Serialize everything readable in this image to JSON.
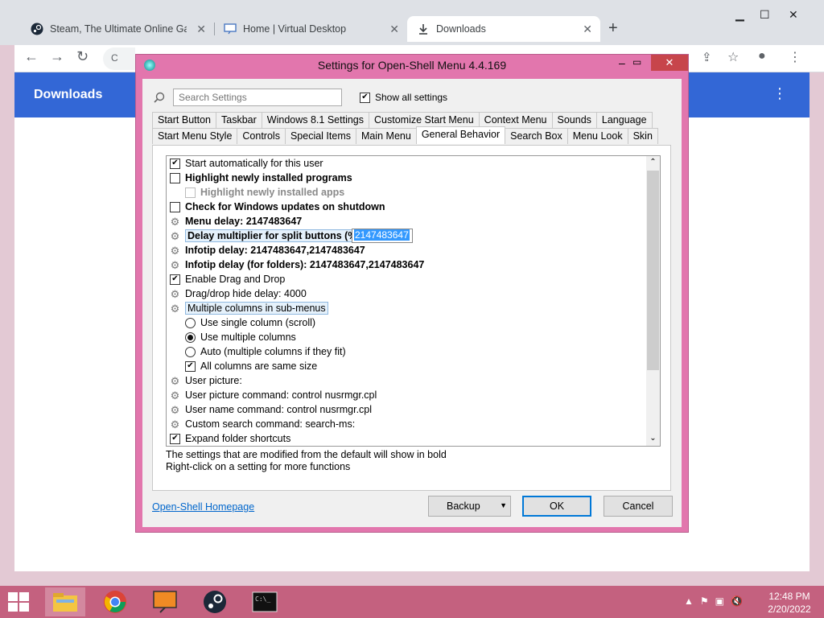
{
  "browser": {
    "tabs": [
      {
        "title": "Steam, The Ultimate Online Gam",
        "icon": "steam-icon"
      },
      {
        "title": "Home | Virtual Desktop",
        "icon": "monitor-icon"
      },
      {
        "title": "Downloads",
        "icon": "download-icon"
      }
    ],
    "omnibox_prefix": "C",
    "page_title": "Downloads"
  },
  "dialog": {
    "title": "Settings for Open-Shell Menu 4.4.169",
    "search_placeholder": "Search Settings",
    "show_all_label": "Show all settings",
    "show_all_checked": true,
    "tabs_row1": [
      "Start Button",
      "Taskbar",
      "Windows 8.1 Settings",
      "Customize Start Menu",
      "Context Menu",
      "Sounds",
      "Language"
    ],
    "tabs_row2": [
      "Start Menu Style",
      "Controls",
      "Special Items",
      "Main Menu",
      "General Behavior",
      "Search Box",
      "Menu Look",
      "Skin"
    ],
    "active_tab": "General Behavior",
    "settings": [
      {
        "type": "checkbox",
        "checked": true,
        "bold": false,
        "indent": 0,
        "label": "Start automatically for this user"
      },
      {
        "type": "checkbox",
        "checked": false,
        "bold": true,
        "indent": 0,
        "label": "Highlight newly installed programs"
      },
      {
        "type": "checkbox",
        "checked": false,
        "bold": true,
        "indent": 1,
        "disabled": true,
        "label": "Highlight newly installed apps"
      },
      {
        "type": "checkbox",
        "checked": false,
        "bold": true,
        "indent": 0,
        "label": "Check for Windows updates on shutdown"
      },
      {
        "type": "gear",
        "bold": true,
        "indent": 0,
        "label": "Menu delay: 2147483647"
      },
      {
        "type": "gear",
        "bold": true,
        "indent": 0,
        "selected": true,
        "label": "Delay multiplier for split buttons (%)"
      },
      {
        "type": "gear",
        "bold": true,
        "indent": 0,
        "label": "Infotip delay: 2147483647,2147483647"
      },
      {
        "type": "gear",
        "bold": true,
        "indent": 0,
        "label": "Infotip delay (for folders): 2147483647,2147483647"
      },
      {
        "type": "checkbox",
        "checked": true,
        "bold": false,
        "indent": 0,
        "label": "Enable Drag and Drop"
      },
      {
        "type": "gear",
        "bold": false,
        "indent": 0,
        "label": "Drag/drop hide delay: 4000"
      },
      {
        "type": "gear",
        "bold": false,
        "indent": 0,
        "selected": true,
        "label": "Multiple columns in sub-menus"
      },
      {
        "type": "radio",
        "checked": false,
        "bold": false,
        "indent": 1,
        "label": "Use single column (scroll)"
      },
      {
        "type": "radio",
        "checked": true,
        "bold": false,
        "indent": 1,
        "label": "Use multiple columns"
      },
      {
        "type": "radio",
        "checked": false,
        "bold": false,
        "indent": 1,
        "label": "Auto (multiple columns if they fit)"
      },
      {
        "type": "checkbox",
        "checked": true,
        "bold": false,
        "indent": 1,
        "label": "All columns are same size"
      },
      {
        "type": "gear",
        "bold": false,
        "indent": 0,
        "label": "User picture:"
      },
      {
        "type": "gear",
        "bold": false,
        "indent": 0,
        "label": "User picture command: control nusrmgr.cpl"
      },
      {
        "type": "gear",
        "bold": false,
        "indent": 0,
        "label": "User name command: control nusrmgr.cpl"
      },
      {
        "type": "gear",
        "bold": false,
        "indent": 0,
        "label": "Custom search command: search-ms:"
      },
      {
        "type": "checkbox",
        "checked": true,
        "bold": false,
        "indent": 0,
        "label": "Expand folder shortcuts"
      }
    ],
    "edit_value": "2147483647",
    "info_line1": "The settings that are modified from the default will show in bold",
    "info_line2": "Right-click on a setting for more functions",
    "homepage_link": "Open-Shell Homepage",
    "backup_label": "Backup",
    "ok_label": "OK",
    "cancel_label": "Cancel"
  },
  "taskbar": {
    "apps": [
      "file-explorer-icon",
      "chrome-icon",
      "virtual-desktop-icon",
      "steam-icon",
      "cmd-icon"
    ],
    "time": "12:48 PM",
    "date": "2/20/2022"
  }
}
